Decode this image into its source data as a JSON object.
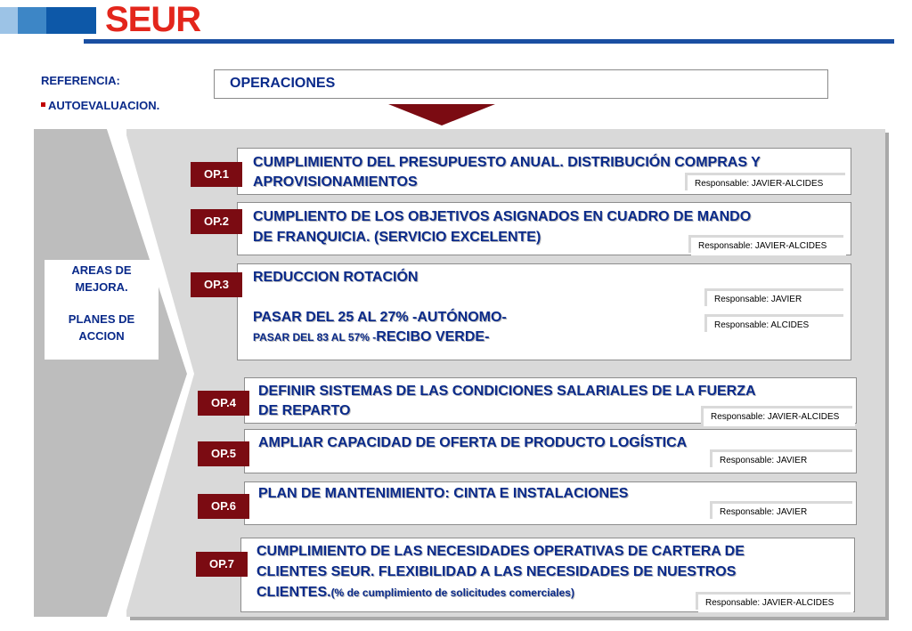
{
  "header": {
    "brand": "SEUR"
  },
  "reference": {
    "title": "REFERENCIA:",
    "item": "AUTOEVALUACION."
  },
  "operations_title": "OPERACIONES",
  "area_box": {
    "line1": "AREAS DE",
    "line2": "MEJORA.",
    "line3": "PLANES DE",
    "line4": "ACCION"
  },
  "ops": [
    {
      "label": "OP.1",
      "line1": "CUMPLIMIENTO DEL PRESUPUESTO ANUAL. DISTRIBUCIÓN  COMPRAS Y",
      "line2": "APROVISIONAMIENTOS",
      "responsible": "Responsable: JAVIER-ALCIDES"
    },
    {
      "label": "OP.2",
      "line1": "CUMPLIENTO DE LOS OBJETIVOS ASIGNADOS EN CUADRO DE MANDO",
      "line2": "DE FRANQUICIA. (SERVICIO EXCELENTE)",
      "responsible": "Responsable: JAVIER-ALCIDES"
    },
    {
      "label": "OP.3",
      "line1": "REDUCCION ROTACIÓN",
      "line2": "PASAR DEL 25 AL 27% -AUTÓNOMO-",
      "line3_small": "PASAR DEL 83 AL 57% -",
      "line3_big": "RECIBO VERDE-",
      "responsible": "Responsable: JAVIER",
      "responsible2": "Responsable: ALCIDES"
    },
    {
      "label": "OP.4",
      "line1": "DEFINIR SISTEMAS DE LAS CONDICIONES SALARIALES DE LA FUERZA",
      "line2": "DE REPARTO",
      "responsible": "Responsable: JAVIER-ALCIDES"
    },
    {
      "label": "OP.5",
      "line1": "AMPLIAR CAPACIDAD DE OFERTA DE PRODUCTO LOGÍSTICA",
      "responsible": "Responsable: JAVIER"
    },
    {
      "label": "OP.6",
      "line1": "PLAN DE MANTENIMIENTO: CINTA E INSTALACIONES",
      "responsible": "Responsable: JAVIER"
    },
    {
      "label": "OP.7",
      "line1": "CUMPLIMIENTO DE LAS NECESIDADES OPERATIVAS DE CARTERA DE",
      "line2": "CLIENTES SEUR. FLEXIBILIDAD A LAS NECESIDADES DE NUESTROS",
      "line3_big": "CLIENTES.",
      "line3_small": "(% de cumplimiento de solicitudes comerciales)",
      "responsible": "Responsable: JAVIER-ALCIDES"
    }
  ],
  "colors": {
    "brand_red": "#e3261c",
    "brand_blue": "#1a4fa2",
    "op_label_bg": "#7b0b12",
    "text_blue": "#0a2a8a",
    "panel_grey": "#d9d9d9"
  }
}
